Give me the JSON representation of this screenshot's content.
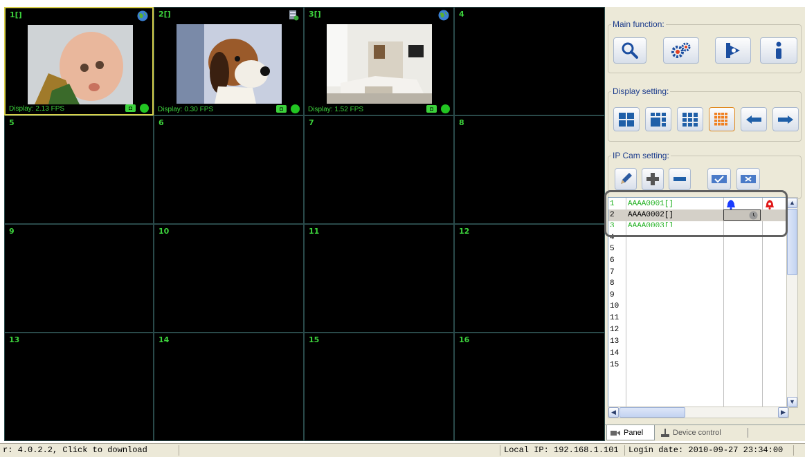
{
  "grid": {
    "cells": [
      {
        "num": "1[]",
        "fps": "Display: 2.13 FPS",
        "icon": "globe-icon"
      },
      {
        "num": "2[]",
        "fps": "Display: 0.30 FPS",
        "icon": "server-icon"
      },
      {
        "num": "3[]",
        "fps": "Display: 1.52 FPS",
        "icon": "globe-icon"
      },
      {
        "num": "4"
      },
      {
        "num": "5"
      },
      {
        "num": "6"
      },
      {
        "num": "7"
      },
      {
        "num": "8"
      },
      {
        "num": "9"
      },
      {
        "num": "10"
      },
      {
        "num": "11"
      },
      {
        "num": "12"
      },
      {
        "num": "13"
      },
      {
        "num": "14"
      },
      {
        "num": "15"
      },
      {
        "num": "16"
      }
    ]
  },
  "panel": {
    "main_function_label": "Main function:",
    "display_setting_label": "Display setting:",
    "ipcam_setting_label": "IP Cam setting:",
    "main_buttons": [
      "search-icon",
      "gear-icon",
      "record-icon",
      "info-icon"
    ],
    "display_buttons": [
      "layout-4-icon",
      "layout-9-icon",
      "layout-16-icon",
      "layout-25-icon",
      "arrow-left-icon",
      "arrow-right-icon"
    ],
    "ipcam_buttons": [
      "edit-icon",
      "add-icon",
      "remove-icon",
      "connect-icon",
      "disconnect-icon"
    ],
    "cam_list": [
      {
        "num": "1",
        "name": "AAAA0001[]"
      },
      {
        "num": "2",
        "name": "AAAA0002[]"
      },
      {
        "num": "3",
        "name": "AAAA0003[]"
      },
      {
        "num": "4",
        "name": ""
      },
      {
        "num": "5",
        "name": ""
      },
      {
        "num": "6",
        "name": ""
      },
      {
        "num": "7",
        "name": ""
      },
      {
        "num": "8",
        "name": ""
      },
      {
        "num": "9",
        "name": ""
      },
      {
        "num": "10",
        "name": ""
      },
      {
        "num": "11",
        "name": ""
      },
      {
        "num": "12",
        "name": ""
      },
      {
        "num": "13",
        "name": ""
      },
      {
        "num": "14",
        "name": ""
      },
      {
        "num": "15",
        "name": ""
      }
    ],
    "tabs": [
      {
        "label": "Panel",
        "icon": "camera-icon"
      },
      {
        "label": "Device control",
        "icon": "joystick-icon"
      }
    ]
  },
  "statusbar": {
    "version": "r: 4.0.2.2, Click to download",
    "local_ip": "Local IP: 192.168.1.101",
    "login_date": "Login date: 2010-09-27 23:34:00"
  },
  "colors": {
    "accent_green": "#3cd23c",
    "panel_bg": "#ece9d8",
    "alarm_blue": "#1a3cff",
    "alarm_red": "#e01818"
  }
}
